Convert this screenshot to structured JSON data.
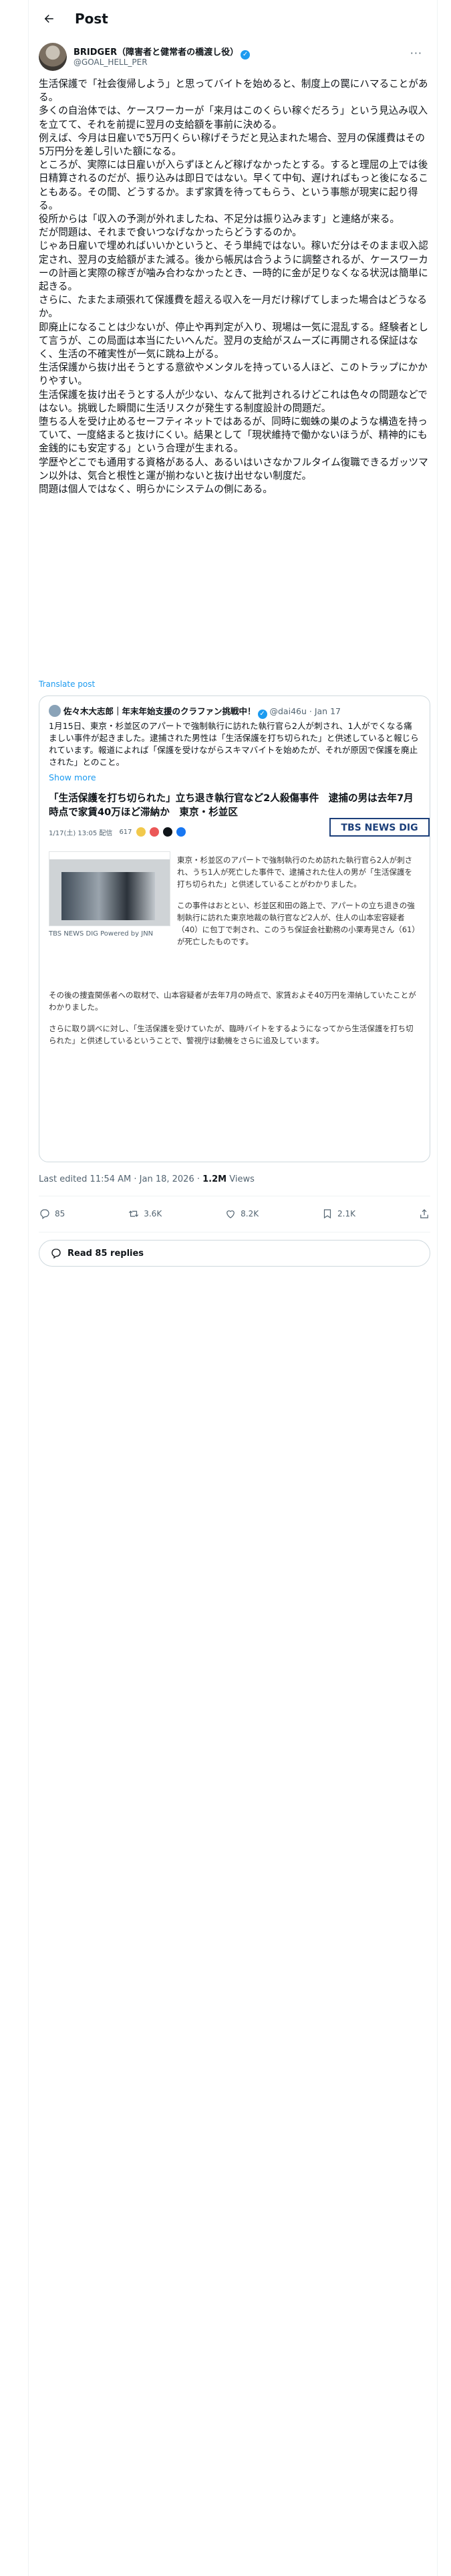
{
  "header": {
    "title": "Post"
  },
  "author": {
    "name": "BRIDGER（障害者と健常者の橋渡し役）",
    "handle": "@GOAL_HELL_PER"
  },
  "post": {
    "paragraphs": [
      "生活保護で「社会復帰しよう」と思ってバイトを始めると、制度上の罠にハマることがある。",
      "多くの自治体では、ケースワーカーが「来月はこのくらい稼ぐだろう」という見込み収入を立てて、それを前提に翌月の支給額を事前に決める。",
      "例えば、今月は日雇いで5万円くらい稼げそうだと見込まれた場合、翌月の保護費はその5万円分を差し引いた額になる。",
      "ところが、実際には日雇いが入らずほとんど稼げなかったとする。すると理屈の上では後日精算されるのだが、振り込みは即日ではない。早くて中旬、遅ければもっと後になることもある。その間、どうするか。まず家賃を待ってもらう、という事態が現実に起り得る。",
      "役所からは「収入の予測が外れましたね、不足分は振り込みます」と連絡が来る。",
      "だが問題は、それまで食いつなげなかったらどうするのか。",
      "じゃあ日雇いで埋めればいいかというと、そう単純ではない。稼いだ分はそのまま収入認定され、翌月の支給額がまた減る。後から帳尻は合うように調整されるが、ケースワーカーの計画と実際の稼ぎが噛み合わなかったとき、一時的に金が足りなくなる状況は簡単に起きる。",
      "さらに、たまたま頑張れて保護費を超える収入を一月だけ稼げてしまった場合はどうなるか。",
      "即廃止になることは少ないが、停止や再判定が入り、現場は一気に混乱する。経験者として言うが、この局面は本当にたいへんだ。翌月の支給がスムーズに再開される保証はなく、生活の不確実性が一気に跳ね上がる。",
      "生活保護から抜け出そうとする意欲やメンタルを持っている人ほど、このトラップにかかりやすい。",
      "生活保護を抜け出そうとする人が少ない、なんて批判されるけどこれは色々の問題などではない。挑戦した瞬間に生活リスクが発生する制度設計の問題だ。",
      "堕ちる人を受け止めるセーフティネットではあるが、同時に蜘蛛の巣のような構造を持っていて、一度絡まると抜けにくい。結果として「現状維持で働かないほうが、精神的にも金銭的にも安定する」という合理が生まれる。",
      "学歴やどこでも通用する資格がある人、あるいはいさなかフルタイム復職できるガッツマン以外は、気合と根性と運が揃わないと抜け出せない制度だ。",
      "問題は個人ではなく、明らかにシステムの側にある。"
    ],
    "translate_label": "Translate post"
  },
  "quote": {
    "name": "佐々木大志郎｜年末年始支援のクラファン挑戦中！",
    "handle": "@dai46u",
    "date": "Jan 17",
    "text": "1月15日、東京・杉並区のアパートで強制執行に訪れた執行官ら2人が刺され、1人がでくなる痛ましい事件が起きました。逮捕された男性は「生活保護を打ち切られた」と供述していると報じられています。報道によれば「保護を受けながらスキマバイトを始めたが、それが原因で保護を廃止された」とのこと。",
    "show_more": "Show more",
    "article_title": "「生活保護を打ち切られた」立ち退き執行官など2人殺傷事件　逮捕の男は去年7月時点で家賃40万ほど滞納か　東京・杉並区",
    "article_meta": "1/17(土) 13:05 配信",
    "article_count": "617",
    "brand": "TBS NEWS DIG",
    "photo_caption": "TBS NEWS DIG Powered by JNN",
    "right_paragraphs": [
      "東京・杉並区のアパートで強制執行のため訪れた執行官ら2人が刺され、うち1人が死亡した事件で、逮捕された住人の男が「生活保護を打ち切られた」と供述していることがわかりました。",
      "この事件はおととい、杉並区和田の路上で、アパートの立ち退きの強制執行に訪れた東京地裁の執行官など2人が、住人の山本宏容疑者（40）に包丁で刺され、このうち保証会社勤務の小栗寿晃さん（61）が死亡したものです。"
    ],
    "bottom_paragraphs": [
      "その後の捜査関係者への取材で、山本容疑者が去年7月の時点で、家賃およそ40万円を滞納していたことがわかりました。",
      "さらに取り調べに対し、「生活保護を受けていたが、臨時バイトをするようになってから生活保護を打ち切られた」と供述しているということで、警視庁は動機をさらに追及しています。"
    ]
  },
  "meta": {
    "last_edited": "Last edited 11:54 AM · Jan 18, 2026 · ",
    "views": "1.2M",
    "views_label": " Views"
  },
  "actions": {
    "replies": "85",
    "reposts": "3.6K",
    "likes": "8.2K",
    "bookmarks": "2.1K"
  },
  "read_replies": "Read 85 replies",
  "colors": {
    "accent": "#1d9bf0",
    "text": "#0f1419",
    "muted": "#536471",
    "border": "#cfd9de"
  }
}
